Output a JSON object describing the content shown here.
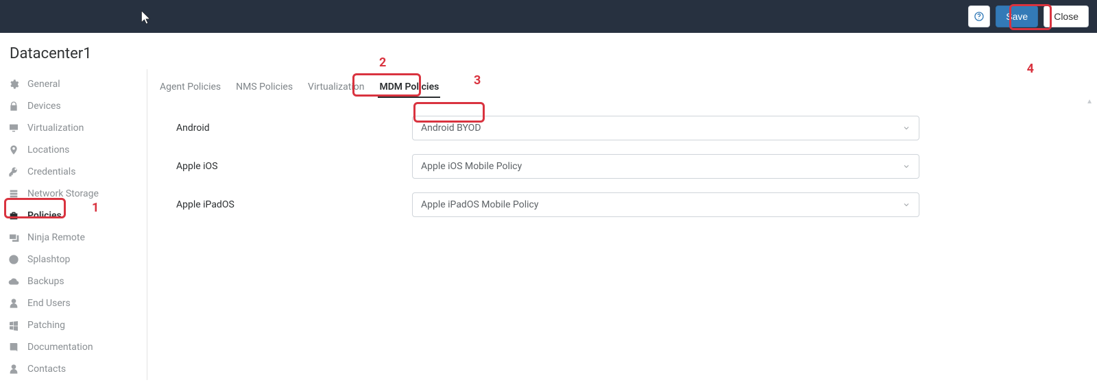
{
  "header": {
    "help_tooltip": "Help",
    "save_label": "Save",
    "close_label": "Close"
  },
  "page_title": "Datacenter1",
  "sidebar": {
    "items": [
      {
        "label": "General",
        "icon": "gear"
      },
      {
        "label": "Devices",
        "icon": "lock"
      },
      {
        "label": "Virtualization",
        "icon": "monitor"
      },
      {
        "label": "Locations",
        "icon": "pin"
      },
      {
        "label": "Credentials",
        "icon": "key"
      },
      {
        "label": "Network Storage",
        "icon": "storage"
      },
      {
        "label": "Policies",
        "icon": "briefcase",
        "active": true
      },
      {
        "label": "Ninja Remote",
        "icon": "remote"
      },
      {
        "label": "Splashtop",
        "icon": "globe"
      },
      {
        "label": "Backups",
        "icon": "cloud"
      },
      {
        "label": "End Users",
        "icon": "person"
      },
      {
        "label": "Patching",
        "icon": "windows"
      },
      {
        "label": "Documentation",
        "icon": "book"
      },
      {
        "label": "Contacts",
        "icon": "person"
      }
    ]
  },
  "tabs": [
    {
      "label": "Agent Policies"
    },
    {
      "label": "NMS Policies"
    },
    {
      "label": "Virtualization"
    },
    {
      "label": "MDM Policies",
      "active": true
    }
  ],
  "rows": [
    {
      "label": "Android",
      "value": "Android BYOD"
    },
    {
      "label": "Apple iOS",
      "value": "Apple iOS Mobile Policy"
    },
    {
      "label": "Apple iPadOS",
      "value": "Apple iPadOS Mobile Policy"
    }
  ],
  "callouts": {
    "1": "1",
    "2": "2",
    "3": "3",
    "4": "4"
  }
}
